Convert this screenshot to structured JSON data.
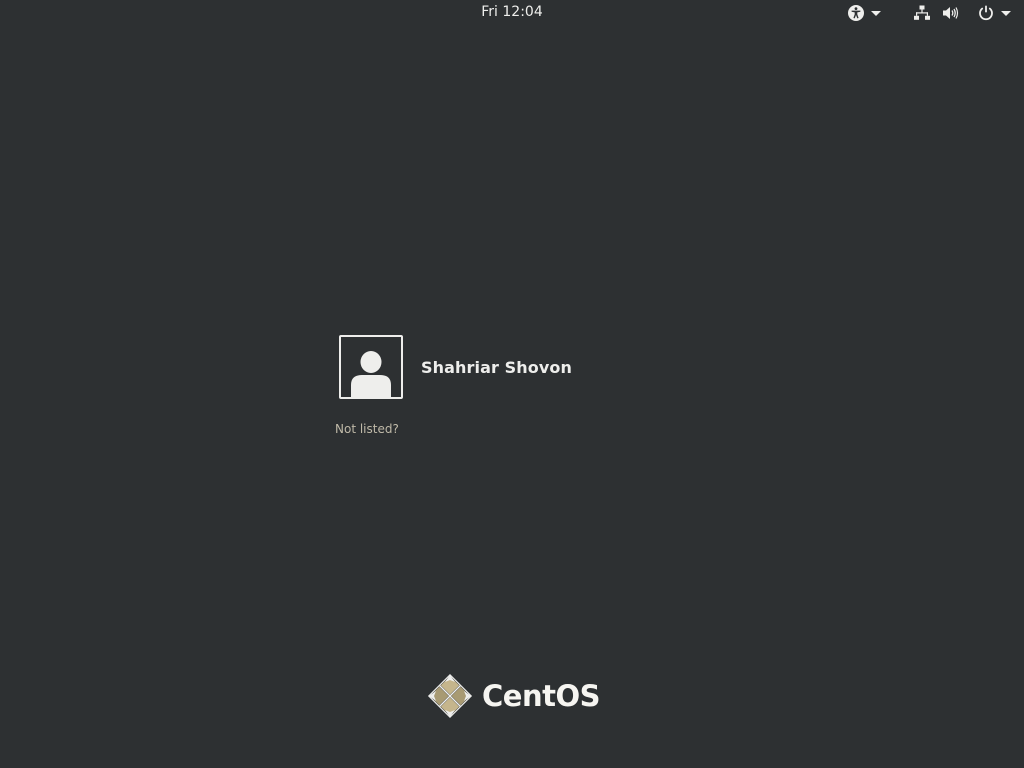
{
  "top_bar": {
    "clock": "Fri 12:04"
  },
  "icons": {
    "accessibility": "accessibility-icon",
    "network": "network-wired-icon",
    "volume": "volume-icon",
    "power": "power-icon",
    "dropdown": "pan-down-icon",
    "avatar": "user-avatar-icon",
    "logo": "centos-logo-icon"
  },
  "user_list": {
    "users": [
      {
        "name": "Shahriar Shovon"
      }
    ],
    "not_listed_label": "Not listed?"
  },
  "branding": {
    "logo_text": "CentOS"
  },
  "colors": {
    "background": "#2d3032",
    "text": "#eeeeec",
    "link": "#bfb9a8",
    "logo_accent_purple": "#932279",
    "logo_accent_green": "#8fb131",
    "logo_tan": "#c5b58c"
  }
}
